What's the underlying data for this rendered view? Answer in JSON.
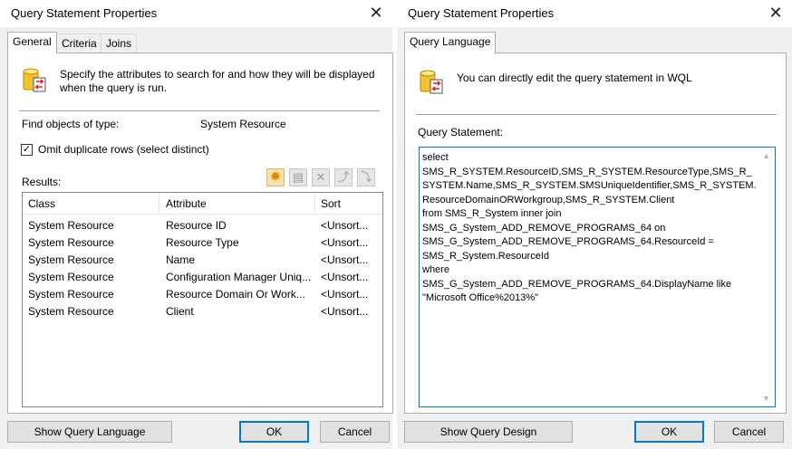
{
  "left_dialog": {
    "title": "Query Statement Properties",
    "close_glyph": "✕",
    "tabs": [
      {
        "label": "General"
      },
      {
        "label": "Criteria"
      },
      {
        "label": "Joins"
      }
    ],
    "description": "Specify the attributes to search for and how they will be displayed when the query is run.",
    "find_label": "Find objects of type:",
    "find_value": "System Resource",
    "omit_duplicates_label": "Omit duplicate rows (select distinct)",
    "omit_duplicates_checked": true,
    "check_glyph": "✓",
    "results_label": "Results:",
    "toolbar_icons": [
      "new-star-icon",
      "properties-icon",
      "delete-icon",
      "move-up-icon",
      "move-down-icon"
    ],
    "table": {
      "columns": [
        "Class",
        "Attribute",
        "Sort"
      ],
      "rows": [
        [
          "System Resource",
          "Resource ID",
          "<Unsort..."
        ],
        [
          "System Resource",
          "Resource Type",
          "<Unsort..."
        ],
        [
          "System Resource",
          "Name",
          "<Unsort..."
        ],
        [
          "System Resource",
          "Configuration Manager Uniq...",
          "<Unsort..."
        ],
        [
          "System Resource",
          "Resource Domain Or Work...",
          "<Unsort..."
        ],
        [
          "System Resource",
          "Client",
          "<Unsort..."
        ]
      ]
    },
    "buttons": {
      "show_query_language": "Show Query Language",
      "ok": "OK",
      "cancel": "Cancel"
    }
  },
  "right_dialog": {
    "title": "Query Statement Properties",
    "close_glyph": "✕",
    "tab": "Query Language",
    "description": "You can directly edit the query statement in WQL",
    "query_label": "Query Statement:",
    "query_text": "select\nSMS_R_SYSTEM.ResourceID,SMS_R_SYSTEM.ResourceType,SMS_R_SYSTEM.Name,SMS_R_SYSTEM.SMSUniqueIdentifier,SMS_R_SYSTEM.ResourceDomainORWorkgroup,SMS_R_SYSTEM.Client\nfrom SMS_R_System inner join\nSMS_G_System_ADD_REMOVE_PROGRAMS_64 on\nSMS_G_System_ADD_REMOVE_PROGRAMS_64.ResourceId =\nSMS_R_System.ResourceId\nwhere\nSMS_G_System_ADD_REMOVE_PROGRAMS_64.DisplayName like\n\"Microsoft Office%2013%\"",
    "buttons": {
      "show_query_design": "Show Query Design",
      "ok": "OK",
      "cancel": "Cancel"
    }
  }
}
